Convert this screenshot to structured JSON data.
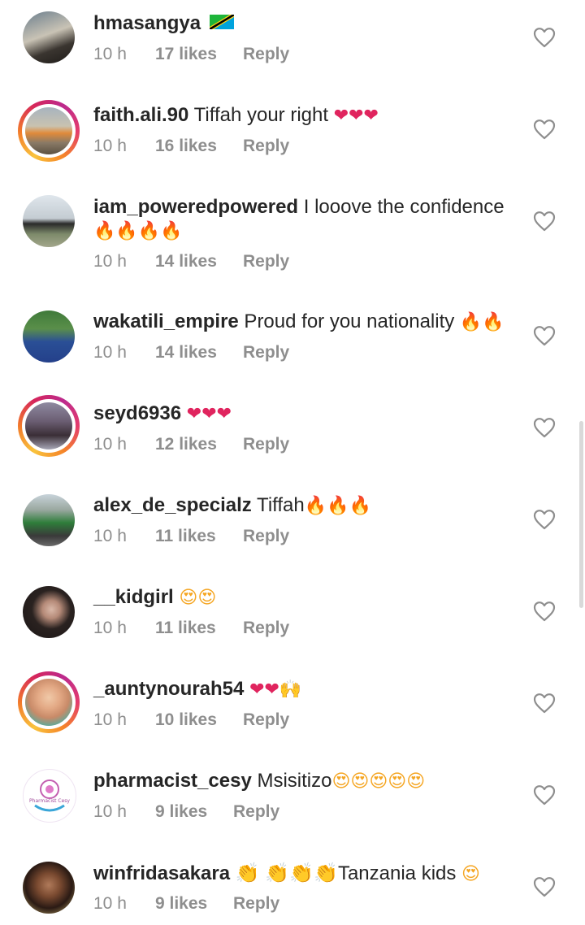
{
  "comments": [
    {
      "user": "hmasangya",
      "text": "",
      "emoji": "flag-tanzania",
      "time": "10 h",
      "likes": "17 likes",
      "reply": "Reply"
    },
    {
      "user": "faith.ali.90",
      "text": " Tiffah  your right ",
      "emoji": "❤❤❤",
      "time": "10 h",
      "likes": "16 likes",
      "reply": "Reply"
    },
    {
      "user": "iam_poweredpowered",
      "text": " I looove the confidence",
      "emoji": "🔥🔥🔥🔥",
      "time": "10 h",
      "likes": "14 likes",
      "reply": "Reply"
    },
    {
      "user": "wakatili_empire",
      "text": " Proud for you nationality ",
      "emoji": "🔥🔥",
      "time": "10 h",
      "likes": "14 likes",
      "reply": "Reply"
    },
    {
      "user": "seyd6936",
      "text": " ",
      "emoji": "❤❤❤",
      "time": "10 h",
      "likes": "12 likes",
      "reply": "Reply"
    },
    {
      "user": "alex_de_specialz",
      "text": " Tiffah",
      "emoji": "🔥🔥🔥",
      "time": "10 h",
      "likes": "11 likes",
      "reply": "Reply"
    },
    {
      "user": "__kidgirl",
      "text": " ",
      "emoji": "😍😍",
      "time": "10 h",
      "likes": "11 likes",
      "reply": "Reply"
    },
    {
      "user": "_auntynourah54",
      "text": " ",
      "emoji": "❤❤🙌",
      "time": "10 h",
      "likes": "10 likes",
      "reply": "Reply"
    },
    {
      "user": "pharmacist_cesy",
      "text": " Msisitizo",
      "emoji": "😍😍😍😍😍",
      "time": "10 h",
      "likes": "9 likes",
      "reply": "Reply"
    },
    {
      "user": "winfridasakara",
      "text": " 👏 👏👏👏Tanzania kids ",
      "emoji": "😍",
      "time": "10 h",
      "likes": "9 likes",
      "reply": "Reply"
    }
  ],
  "avatar_text": {
    "pharmacist_cesy": "Pharmacist Cesy"
  },
  "colors": {
    "username": "#262626",
    "meta": "#8e8e8e",
    "heart": "#e0245e",
    "fire": "#f06b1f"
  }
}
